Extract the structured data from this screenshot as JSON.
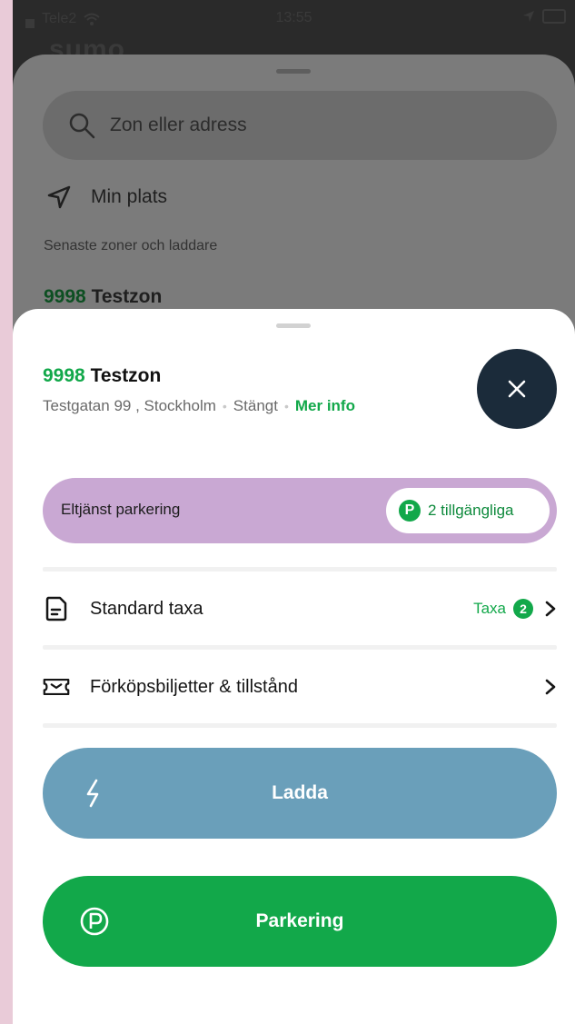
{
  "status_bar": {
    "carrier": "Tele2",
    "time": "13:55"
  },
  "background": {
    "logo_peek": "sumo",
    "search_placeholder": "Zon eller adress",
    "my_location": "Min plats",
    "recent_header": "Senaste zoner och laddare",
    "recent_zone": {
      "number": "9998",
      "name": "Testzon"
    }
  },
  "zone": {
    "number": "9998",
    "name": "Testzon",
    "address": "Testgatan 99 , Stockholm",
    "status": "Stängt",
    "more_info": "Mer info"
  },
  "service": {
    "label": "Eltjänst parkering",
    "badge_letter": "P",
    "available": "2 tillgängliga"
  },
  "rows": {
    "standard_taxa": {
      "label": "Standard taxa",
      "right_label": "Taxa",
      "count": "2"
    },
    "tickets": {
      "label": "Förköpsbiljetter & tillstånd"
    }
  },
  "buttons": {
    "charge": "Ladda",
    "park": "Parkering"
  },
  "colors": {
    "brand_green": "#12a84a",
    "charge_blue": "#6a9fba",
    "service_purple": "#c9a8d3",
    "close_dark": "#1b2b3a"
  }
}
